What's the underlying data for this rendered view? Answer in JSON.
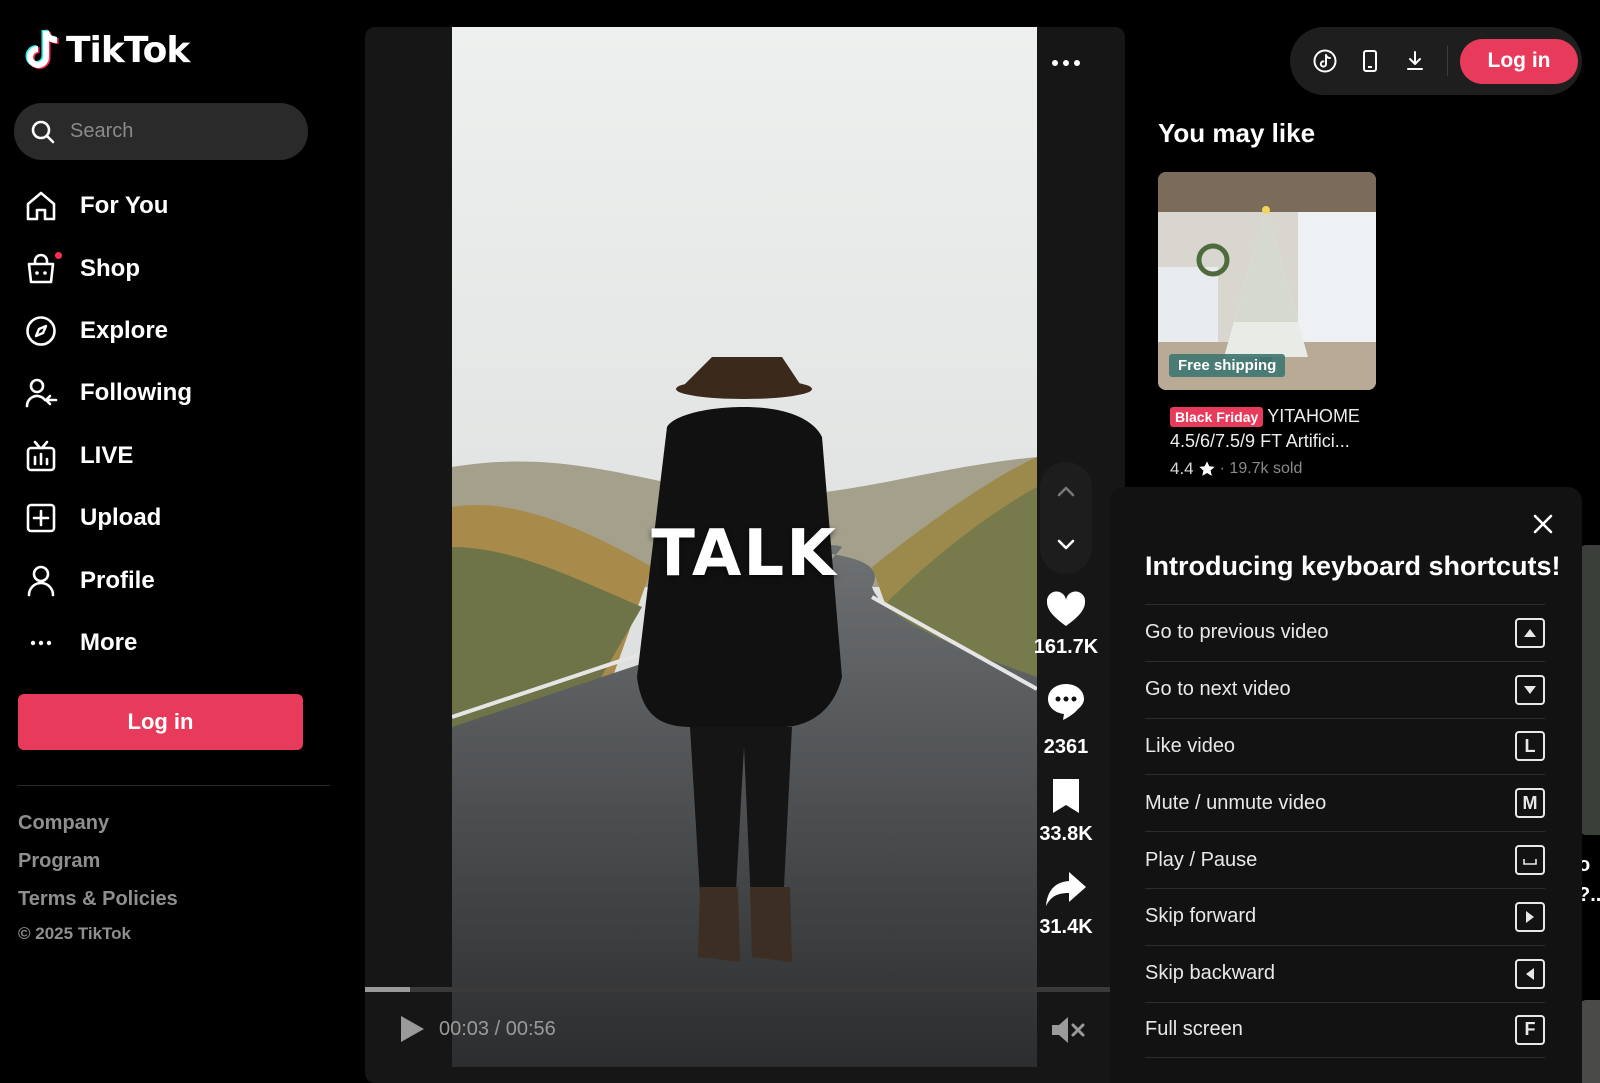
{
  "brand": {
    "name": "TikTok"
  },
  "search": {
    "placeholder": "Search"
  },
  "nav": {
    "items": [
      {
        "label": "For You",
        "icon": "home-icon"
      },
      {
        "label": "Shop",
        "icon": "shopping-bag-icon"
      },
      {
        "label": "Explore",
        "icon": "compass-icon"
      },
      {
        "label": "Following",
        "icon": "following-icon"
      },
      {
        "label": "LIVE",
        "icon": "live-tv-icon"
      },
      {
        "label": "Upload",
        "icon": "plus-square-icon"
      },
      {
        "label": "Profile",
        "icon": "person-icon"
      },
      {
        "label": "More",
        "icon": "more-dots-icon"
      }
    ]
  },
  "sidebar": {
    "login_label": "Log in"
  },
  "footer": {
    "links": [
      "Company",
      "Program",
      "Terms & Policies"
    ],
    "copyright": "© 2025 TikTok"
  },
  "video": {
    "caption": "TALK",
    "likes": "161.7K",
    "comments": "2361",
    "saves": "33.8K",
    "shares": "31.4K",
    "time": "00:03 / 00:56",
    "progress": 0.06
  },
  "topbar": {
    "login_label": "Log in"
  },
  "recommendations": {
    "title": "You may like",
    "product": {
      "badge": "Black Friday",
      "name": "YITAHOME 4.5/6/7.5/9 FT Artifici...",
      "shipping": "Free shipping",
      "rating": "4.4",
      "sold": "· 19.7k sold"
    },
    "peek_text": "o\n?..."
  },
  "shortcuts": {
    "title": "Introducing keyboard shortcuts!",
    "items": [
      {
        "label": "Go to previous video",
        "key": "",
        "key_icon": "arrow-up-key-icon"
      },
      {
        "label": "Go to next video",
        "key": "",
        "key_icon": "arrow-down-key-icon"
      },
      {
        "label": "Like video",
        "key": "L",
        "key_icon": ""
      },
      {
        "label": "Mute / unmute video",
        "key": "M",
        "key_icon": ""
      },
      {
        "label": "Play / Pause",
        "key": "",
        "key_icon": "space-key-icon"
      },
      {
        "label": "Skip forward",
        "key": "",
        "key_icon": "arrow-right-key-icon"
      },
      {
        "label": "Skip backward",
        "key": "",
        "key_icon": "arrow-left-key-icon"
      },
      {
        "label": "Full screen",
        "key": "F",
        "key_icon": ""
      }
    ]
  },
  "colors": {
    "accent": "#e83a5b",
    "background": "#000000",
    "panel": "#121212"
  }
}
